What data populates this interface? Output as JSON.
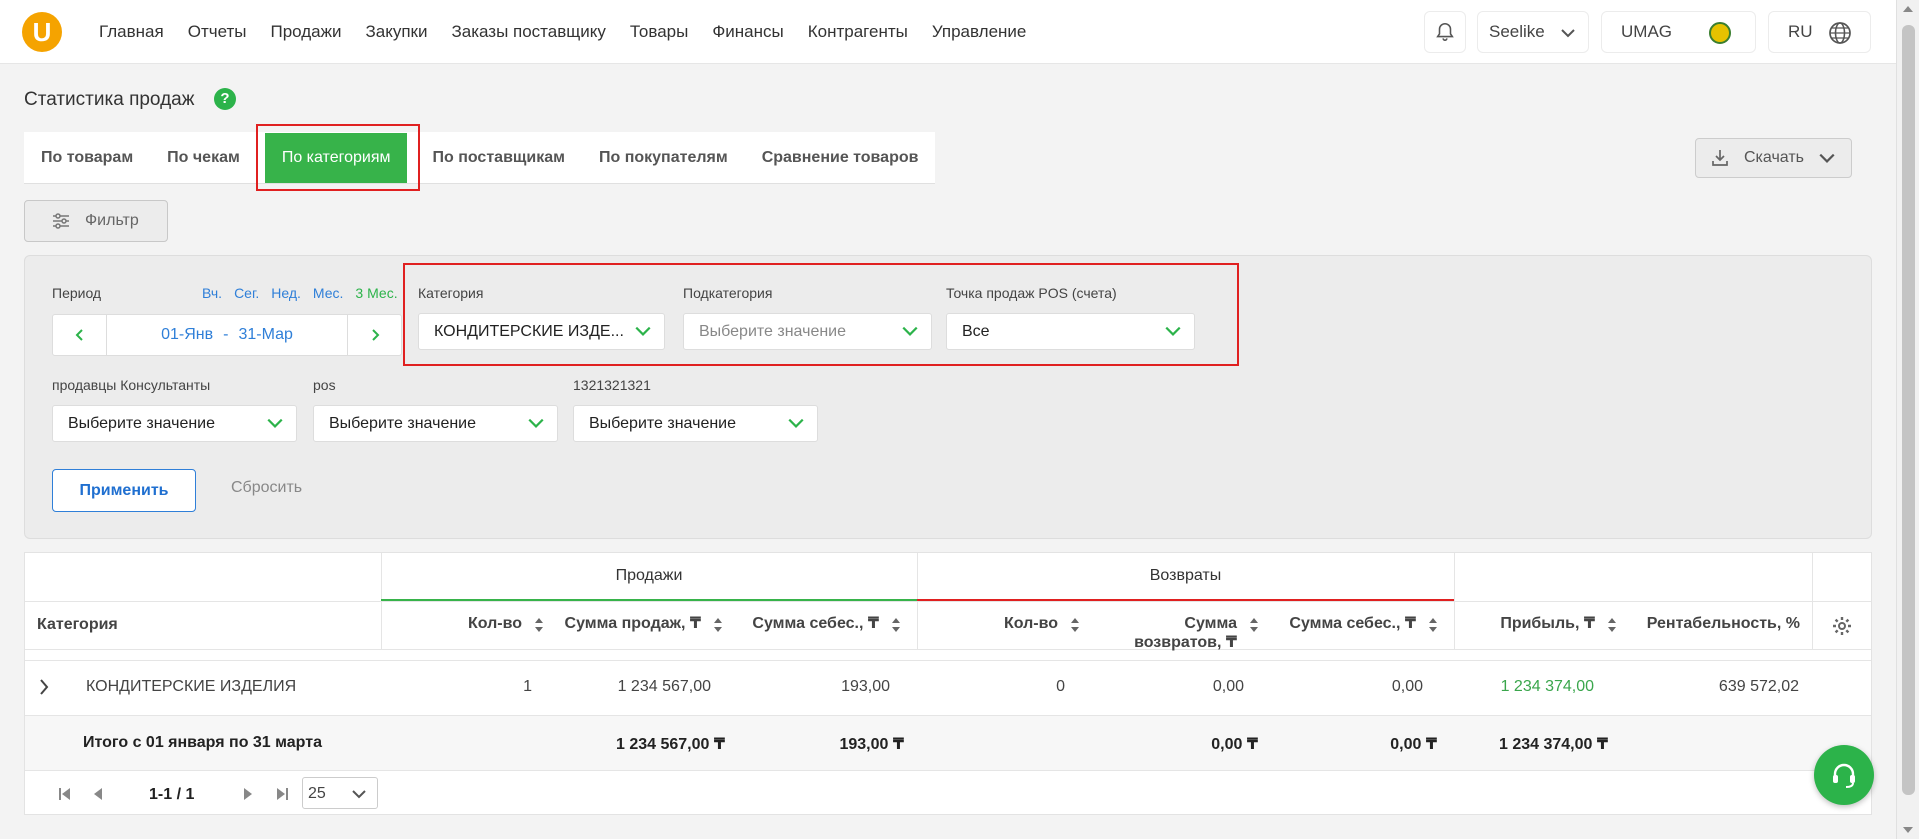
{
  "nav": {
    "logo": "U",
    "items": [
      "Главная",
      "Отчеты",
      "Продажи",
      "Закупки",
      "Заказы поставщику",
      "Товары",
      "Финансы",
      "Контрагенты",
      "Управление"
    ],
    "store": "Seelike",
    "account": "UMAG",
    "language": "RU"
  },
  "page": {
    "title": "Статистика продаж",
    "help": "?"
  },
  "tabs": [
    {
      "label": "По товарам"
    },
    {
      "label": "По чекам"
    },
    {
      "label": "По категориям"
    },
    {
      "label": "По поставщикам"
    },
    {
      "label": "По покупателям"
    },
    {
      "label": "Сравнение товаров"
    }
  ],
  "active_tab": "По категориям",
  "download": {
    "label": "Скачать"
  },
  "filter": {
    "label": "Фильтр"
  },
  "filters": {
    "period_label": "Период",
    "quick": [
      "Вч.",
      "Сег.",
      "Нед.",
      "Мес.",
      "3 Мес."
    ],
    "quick_active": "3 Мес.",
    "period_from": "01-Янв",
    "period_sep": "-",
    "period_to": "31-Мар",
    "category_label": "Категория",
    "category_value": "КОНДИТЕРСКИЕ ИЗДЕ...",
    "subcategory_label": "Подкатегория",
    "subcategory_placeholder": "Выберите значение",
    "pos_point_label": "Точка продаж POS (счета)",
    "pos_point_value": "Все",
    "sellers_label": "продавцы Консультанты",
    "sellers_placeholder": "Выберите значение",
    "pos_label": "pos",
    "pos_placeholder": "Выберите значение",
    "custom_label": "1321321321",
    "custom_placeholder": "Выберите значение",
    "apply": "Применить",
    "reset": "Сбросить"
  },
  "table": {
    "groups": {
      "sales": "Продажи",
      "returns": "Возвраты"
    },
    "headers": {
      "category": "Категория",
      "qty": "Кол-во",
      "sales_sum": "Сумма продаж, ₸",
      "sales_cost": "Сумма себес., ₸",
      "ret_qty": "Кол-во",
      "ret_sum": "Сумма возвратов, ₸",
      "ret_cost": "Сумма себес., ₸",
      "profit": "Прибыль, ₸",
      "margin": "Рентабельность, %"
    },
    "rows": [
      {
        "category": "КОНДИТЕРСКИЕ ИЗДЕЛИЯ",
        "qty": "1",
        "sales_sum": "1 234 567,00",
        "sales_cost": "193,00",
        "ret_qty": "0",
        "ret_sum": "0,00",
        "ret_cost": "0,00",
        "profit": "1 234 374,00",
        "margin": "639 572,02"
      }
    ],
    "total": {
      "label": "Итого с 01 января по 31 марта",
      "sales_sum": "1 234 567,00 ₸",
      "sales_cost": "193,00 ₸",
      "ret_sum": "0,00 ₸",
      "ret_cost": "0,00 ₸",
      "profit": "1 234 374,00 ₸"
    },
    "pager": {
      "range": "1-1 / 1",
      "page_size": "25"
    }
  },
  "colors": {
    "accent": "#37b34a",
    "link": "#2f7fd8",
    "highlight": "#e02020",
    "brand": "#f5a300"
  }
}
